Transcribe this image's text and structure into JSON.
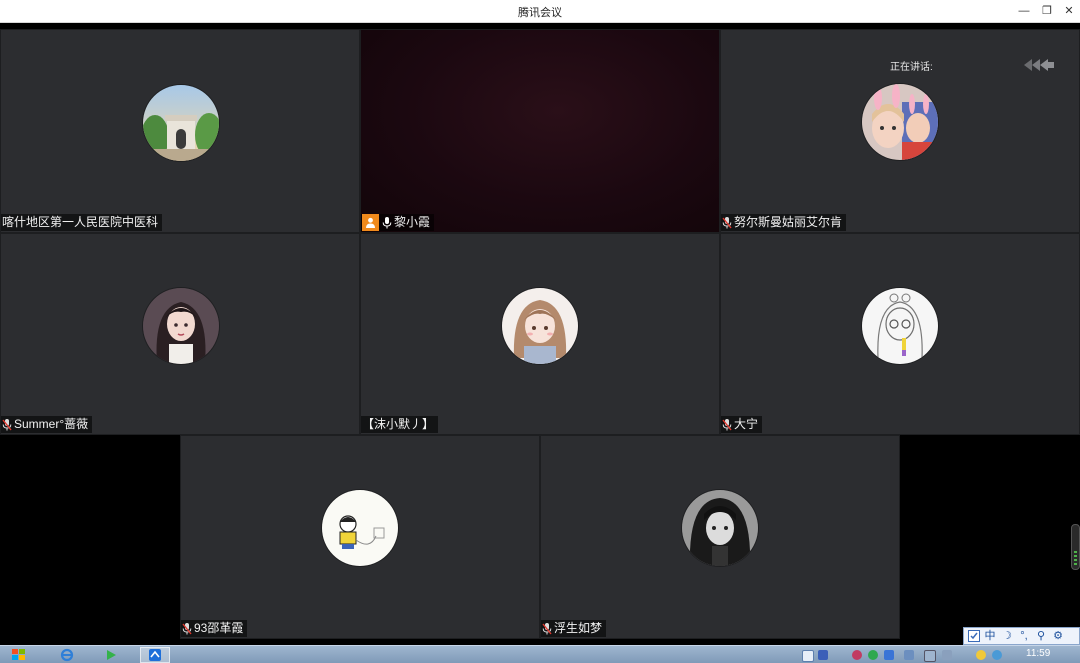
{
  "window": {
    "title": "腾讯会议",
    "minimize_glyph": "—",
    "restore_glyph": "❐",
    "close_glyph": "✕"
  },
  "speaking_label": "正在讲话:",
  "participants": [
    {
      "name": "喀什地区第一人民医院中医科",
      "mic": "none",
      "avatar": "gate-icon"
    },
    {
      "name": "黎小霞",
      "mic": "active",
      "host": true,
      "avatar": "video-feed"
    },
    {
      "name": "努尔斯曼姑丽艾尔肯",
      "mic": "muted",
      "avatar": "bunny-filter-photo"
    },
    {
      "name": "Summer°蔷薇",
      "mic": "muted",
      "avatar": "anime-girl-dark-hair"
    },
    {
      "name": "【沫小默丿】",
      "mic": "none",
      "avatar": "anime-girl-brown-hair"
    },
    {
      "name": "大宁",
      "mic": "muted",
      "avatar": "sketch-girl"
    },
    {
      "name": "93邵革霞",
      "mic": "muted",
      "avatar": "cartoon-boy-sitting"
    },
    {
      "name": "浮生如梦",
      "mic": "muted",
      "avatar": "monochrome-girl"
    }
  ],
  "ime": {
    "items": [
      "中",
      "☽",
      "°,",
      "⚲",
      "⚙"
    ],
    "selected": "中"
  },
  "taskbar": {
    "clock": "11:59"
  },
  "colors": {
    "tile_bg": "#2c2d30",
    "host_badge": "#f08a1c",
    "taskbar": "#8aa4c2"
  }
}
